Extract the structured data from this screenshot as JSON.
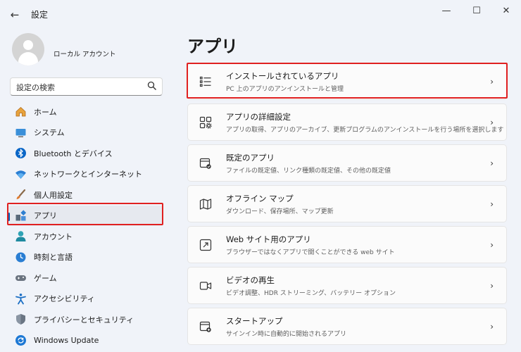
{
  "window": {
    "title": "設定",
    "back_glyph": "←",
    "controls": {
      "minimize": "—",
      "maximize": "☐",
      "close": "✕"
    }
  },
  "profile": {
    "name": "ローカル アカウント"
  },
  "search": {
    "placeholder": "設定の検索",
    "icon": "search-icon"
  },
  "sidebar": {
    "items": [
      {
        "label": "ホーム",
        "icon": "home-icon"
      },
      {
        "label": "システム",
        "icon": "system-icon"
      },
      {
        "label": "Bluetooth とデバイス",
        "icon": "bluetooth-icon"
      },
      {
        "label": "ネットワークとインターネット",
        "icon": "wifi-icon"
      },
      {
        "label": "個人用設定",
        "icon": "brush-icon"
      },
      {
        "label": "アプリ",
        "icon": "apps-icon",
        "selected": true
      },
      {
        "label": "アカウント",
        "icon": "account-icon"
      },
      {
        "label": "時刻と言語",
        "icon": "clock-icon"
      },
      {
        "label": "ゲーム",
        "icon": "gamepad-icon"
      },
      {
        "label": "アクセシビリティ",
        "icon": "accessibility-icon"
      },
      {
        "label": "プライバシーとセキュリティ",
        "icon": "shield-icon"
      },
      {
        "label": "Windows Update",
        "icon": "update-icon"
      }
    ]
  },
  "main": {
    "title": "アプリ",
    "cards": [
      {
        "title": "インストールされているアプリ",
        "subtitle": "PC 上のアプリのアンインストールと管理",
        "icon": "list-icon"
      },
      {
        "title": "アプリの詳細設定",
        "subtitle": "アプリの取得、アプリのアーカイブ、更新プログラムのアンインストールを行う場所を選択します",
        "icon": "app-settings-icon"
      },
      {
        "title": "既定のアプリ",
        "subtitle": "ファイルの既定値、リンク種類の既定値、その他の既定値",
        "icon": "default-apps-icon"
      },
      {
        "title": "オフライン マップ",
        "subtitle": "ダウンロード、保存場所、マップ更新",
        "icon": "map-icon"
      },
      {
        "title": "Web サイト用のアプリ",
        "subtitle": "ブラウザーではなくアプリで開くことができる web サイト",
        "icon": "open-in-app-icon"
      },
      {
        "title": "ビデオの再生",
        "subtitle": "ビデオ調整、HDR ストリーミング、バッテリー オプション",
        "icon": "video-icon"
      },
      {
        "title": "スタートアップ",
        "subtitle": "サインイン時に自動的に開始されるアプリ",
        "icon": "startup-icon"
      }
    ],
    "chevron": "›"
  },
  "colors": {
    "accent": "#005fb8",
    "highlight": "#e02020",
    "background": "#f0f3f9",
    "card": "#fbfbfb"
  }
}
